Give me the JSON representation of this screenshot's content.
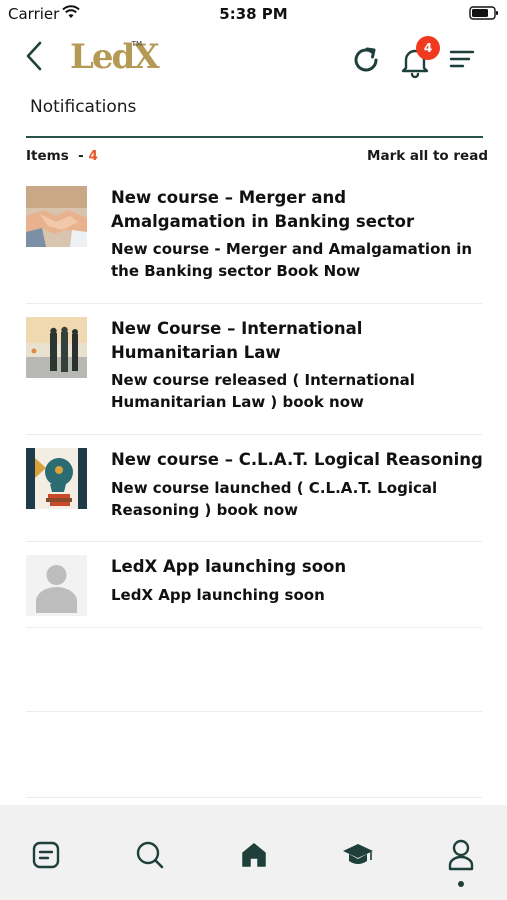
{
  "status_bar": {
    "carrier": "Carrier",
    "time": "5:38 PM"
  },
  "header": {
    "logo_text": "LedX",
    "logo_tm": "TM",
    "notification_badge": "4",
    "accent_color": "#26544a",
    "badge_color": "#f03a1f"
  },
  "page": {
    "title": "Notifications",
    "items_label": "Items  - ",
    "items_count": "4",
    "mark_all_label": "Mark all to read"
  },
  "notifications": [
    {
      "thumbnail": "handshake-image",
      "title": "New course – Merger and Amalgamation in Banking sector",
      "body": "New course - Merger and Amalgamation in the Banking sector Book Now"
    },
    {
      "thumbnail": "soldiers-image",
      "title": "New Course – International Humanitarian Law",
      "body": "New course released ( International Humanitarian Law ) book now"
    },
    {
      "thumbnail": "head-scales-image",
      "title": "New course – C.L.A.T. Logical Reasoning",
      "body": "New course launched ( C.L.A.T. Logical Reasoning ) book now"
    },
    {
      "thumbnail": "placeholder-avatar-image",
      "title": "LedX App launching soon",
      "body": "LedX App launching soon"
    }
  ],
  "tab_bar": {
    "tabs": [
      "notes-icon",
      "search-icon",
      "home-icon",
      "graduation-cap-icon",
      "profile-icon"
    ],
    "active": "profile-icon"
  }
}
